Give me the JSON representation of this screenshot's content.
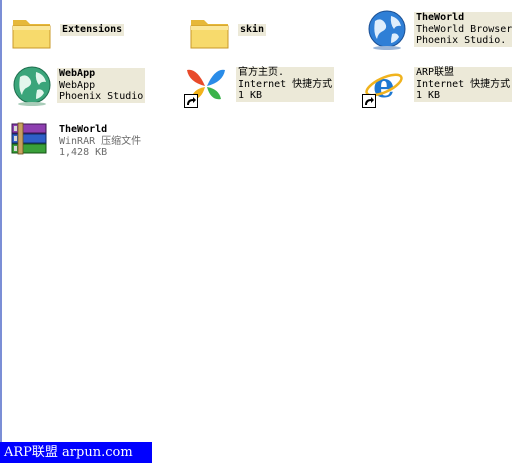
{
  "items": [
    {
      "name": "Extensions",
      "lines": []
    },
    {
      "name": "skin",
      "lines": []
    },
    {
      "name": "TheWorld",
      "lines": [
        "TheWorld Browser",
        "Phoenix Studio."
      ]
    },
    {
      "name": "WebApp",
      "lines": [
        "WebApp",
        "Phoenix Studio"
      ]
    },
    {
      "name": "官方主页.",
      "lines": [
        "Internet 快捷方式",
        "1 KB"
      ]
    },
    {
      "name": "ARP联盟",
      "lines": [
        "Internet 快捷方式",
        "1 KB"
      ]
    },
    {
      "name": "TheWorld",
      "lines": [
        "WinRAR 压缩文件",
        "1,428 KB"
      ]
    }
  ],
  "watermark": "ARP联盟 arpun.com",
  "colors": {
    "folder": "#f5d767",
    "selection_bg": "#ece9d8",
    "footer_bg": "#0000ff"
  }
}
